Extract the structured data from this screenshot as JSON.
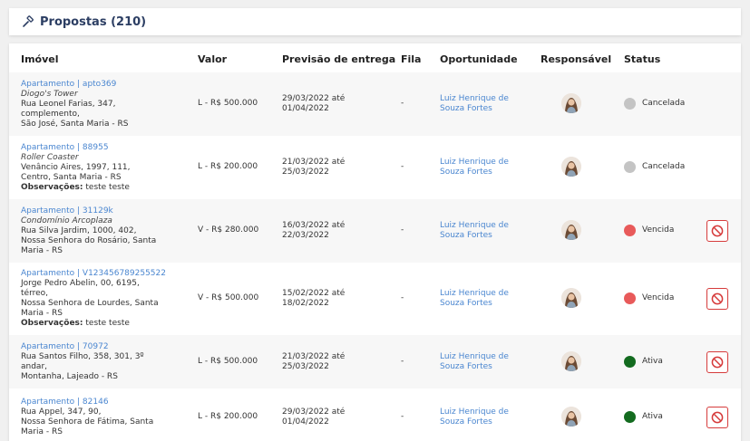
{
  "page": {
    "title": "Propostas (210)"
  },
  "table": {
    "headers": {
      "imovel": "Imóvel",
      "valor": "Valor",
      "previsao": "Previsão de entrega",
      "fila": "Fila",
      "oportunidade": "Oportunidade",
      "responsavel": "Responsável",
      "status": "Status"
    },
    "rows": [
      {
        "link": "Apartamento | apto369",
        "name": "Diogo's Tower",
        "addr": [
          "Rua Leonel Farias, 347,",
          "complemento,",
          "São José, Santa Maria - RS"
        ],
        "obs_label": "",
        "obs_value": "",
        "valor": "L - R$ 500.000",
        "previsao": [
          "29/03/2022 até",
          "01/04/2022"
        ],
        "fila": "-",
        "oportunidade": [
          "Luiz Henrique de",
          "Souza Fortes"
        ],
        "status": "Cancelada",
        "status_color": "#c4c4c4",
        "cancel": false
      },
      {
        "link": "Apartamento | 88955",
        "name": "Roller Coaster",
        "addr": [
          "Venâncio Aires, 1997, 111,",
          "Centro, Santa Maria - RS"
        ],
        "obs_label": "Observações:",
        "obs_value": " teste teste",
        "valor": "L - R$ 200.000",
        "previsao": [
          "21/03/2022 até",
          "25/03/2022"
        ],
        "fila": "-",
        "oportunidade": [
          "Luiz Henrique de",
          "Souza Fortes"
        ],
        "status": "Cancelada",
        "status_color": "#c4c4c4",
        "cancel": false
      },
      {
        "link": "Apartamento | 31129k",
        "name": "Condomínio Arcoplaza",
        "addr": [
          "Rua Silva Jardim, 1000, 402,",
          "Nossa Senhora do Rosário, Santa",
          "Maria - RS"
        ],
        "obs_label": "",
        "obs_value": "",
        "valor": "V - R$ 280.000",
        "previsao": [
          "16/03/2022 até",
          "22/03/2022"
        ],
        "fila": "-",
        "oportunidade": [
          "Luiz Henrique de",
          "Souza Fortes"
        ],
        "status": "Vencida",
        "status_color": "#e85a5a",
        "cancel": true
      },
      {
        "link": "Apartamento | V123456789255522",
        "name": "",
        "addr": [
          "Jorge Pedro Abelin, 00, 6195,",
          "térreo,",
          "Nossa Senhora de Lourdes, Santa",
          "Maria - RS"
        ],
        "obs_label": "Observações:",
        "obs_value": " teste teste",
        "valor": "V - R$ 500.000",
        "previsao": [
          "15/02/2022 até",
          "18/02/2022"
        ],
        "fila": "-",
        "oportunidade": [
          "Luiz Henrique de",
          "Souza Fortes"
        ],
        "status": "Vencida",
        "status_color": "#e85a5a",
        "cancel": true
      },
      {
        "link": "Apartamento | 70972",
        "name": "",
        "addr": [
          "Rua Santos Filho, 358, 301, 3º",
          "andar,",
          "Montanha, Lajeado - RS"
        ],
        "obs_label": "",
        "obs_value": "",
        "valor": "L - R$ 500.000",
        "previsao": [
          "21/03/2022 até",
          "25/03/2022"
        ],
        "fila": "-",
        "oportunidade": [
          "Luiz Henrique de",
          "Souza Fortes"
        ],
        "status": "Ativa",
        "status_color": "#136b1f",
        "cancel": true
      },
      {
        "link": "Apartamento | 82146",
        "name": "",
        "addr": [
          "Rua Appel, 347, 90,",
          "Nossa Senhora de Fátima, Santa",
          "Maria - RS"
        ],
        "obs_label": "",
        "obs_value": "",
        "valor": "L - R$ 200.000",
        "previsao": [
          "29/03/2022 até",
          "01/04/2022"
        ],
        "fila": "-",
        "oportunidade": [
          "Luiz Henrique de",
          "Souza Fortes"
        ],
        "status": "Ativa",
        "status_color": "#136b1f",
        "cancel": true
      }
    ]
  }
}
